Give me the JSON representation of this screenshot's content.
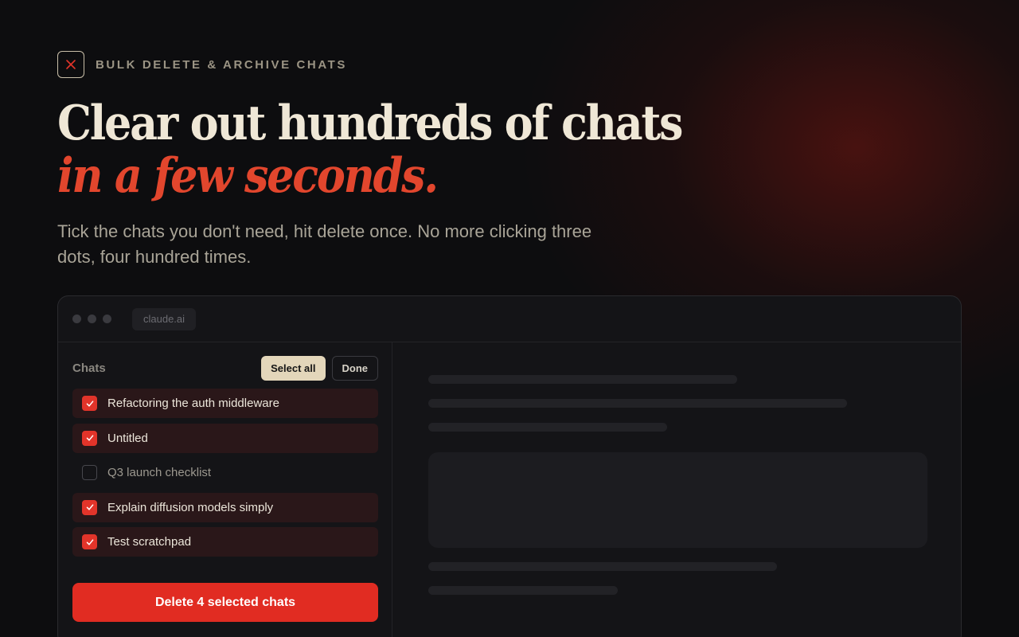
{
  "eyebrow": {
    "icon": "close-icon",
    "label": "BULK DELETE & ARCHIVE CHATS"
  },
  "headline": {
    "line1": "Clear out hundreds of chats",
    "line2": "in a few seconds."
  },
  "subtitle": "Tick the chats you don't need, hit delete once. No more clicking three dots, four hundred times.",
  "window": {
    "url": "claude.ai",
    "sidebar": {
      "title": "Chats",
      "select_all_label": "Select all",
      "done_label": "Done",
      "chats": [
        {
          "label": "Refactoring the auth middleware",
          "checked": true
        },
        {
          "label": "Untitled",
          "checked": true
        },
        {
          "label": "Q3 launch checklist",
          "checked": false
        },
        {
          "label": "Explain diffusion models simply",
          "checked": true
        },
        {
          "label": "Test scratchpad",
          "checked": true
        }
      ],
      "delete_label": "Delete 4 selected chats"
    }
  },
  "colors": {
    "accent": "#e2342a",
    "headline_accent": "#e2462d",
    "background": "#0d0d0f",
    "cream": "#efe7d6"
  }
}
